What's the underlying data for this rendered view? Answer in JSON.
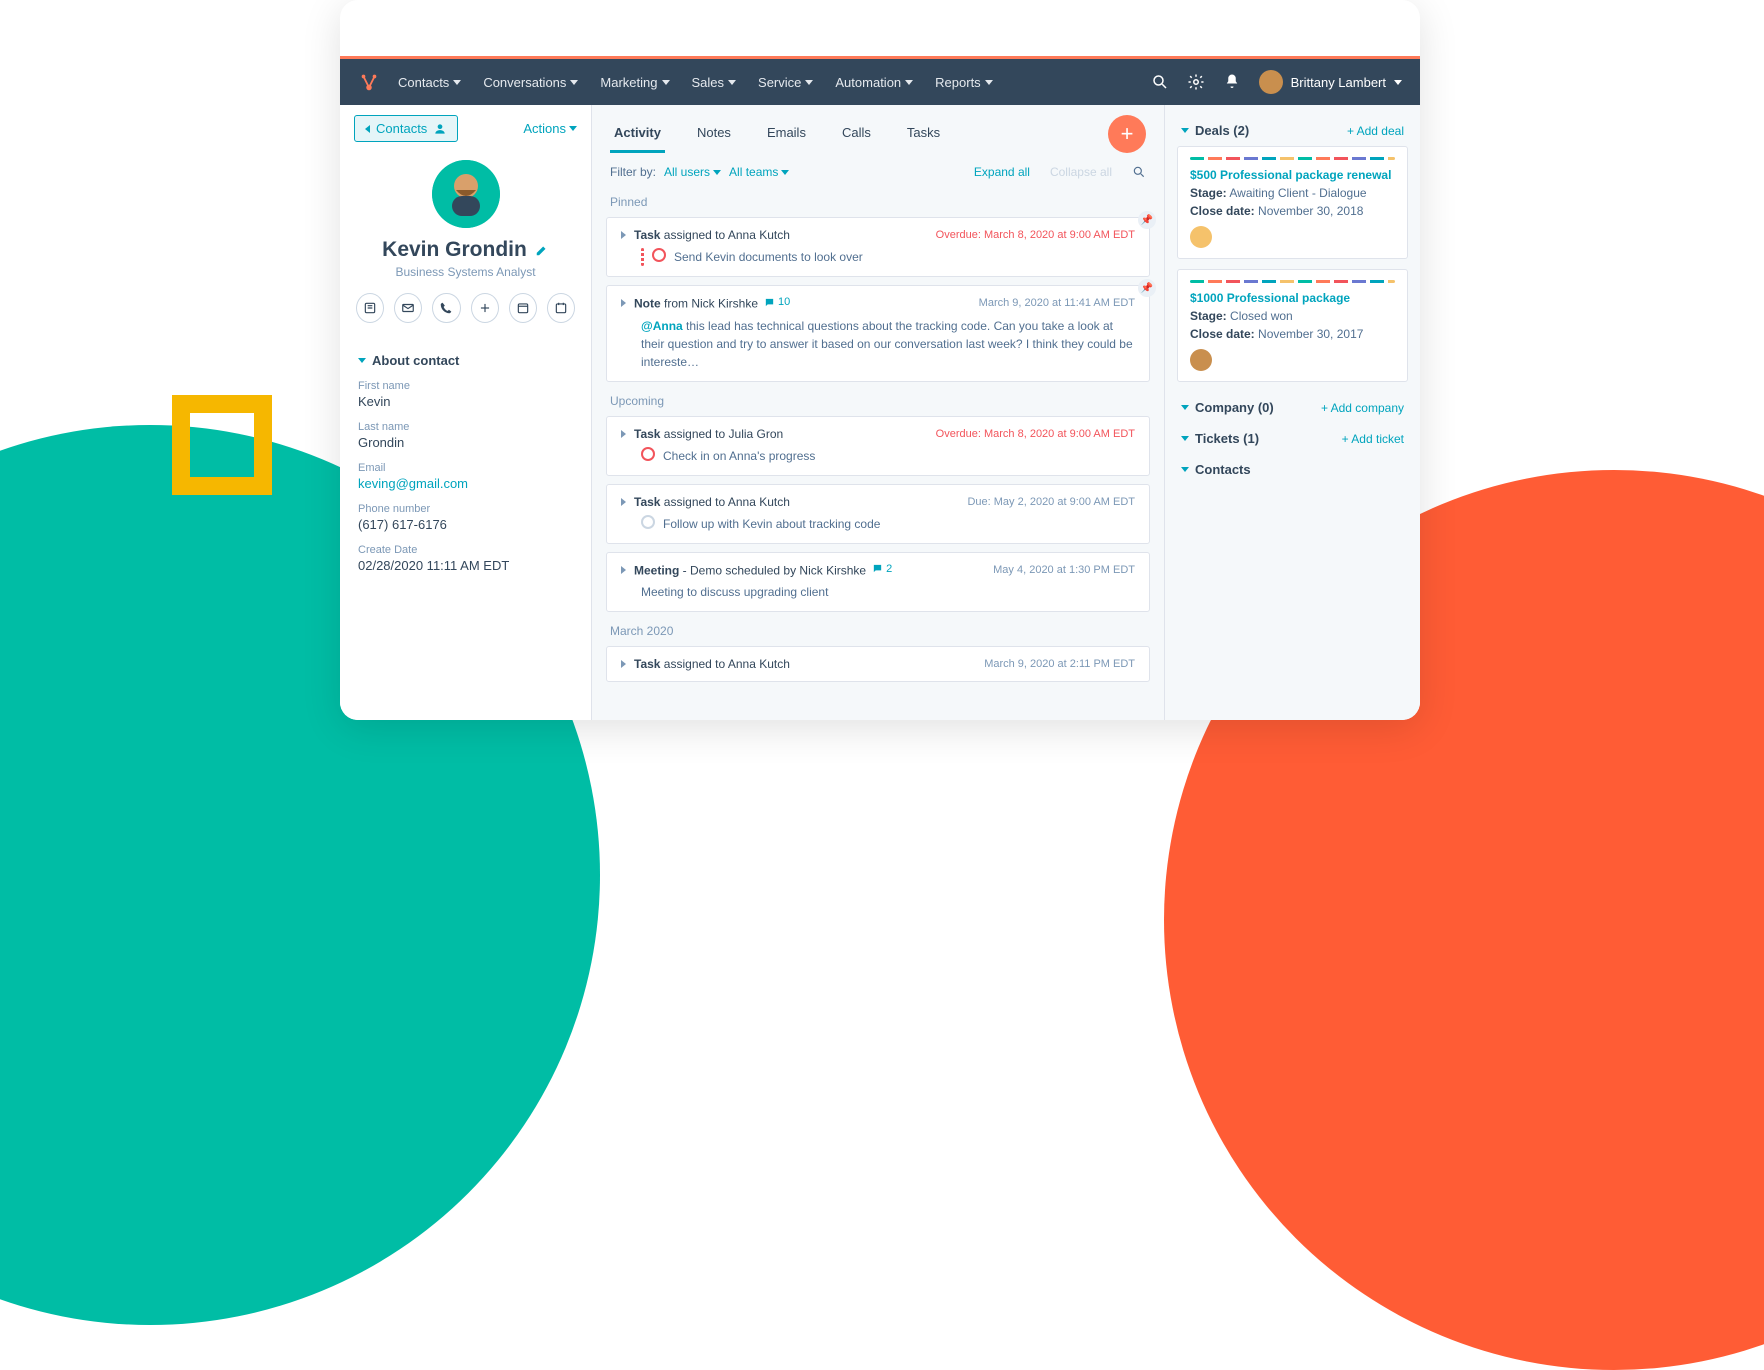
{
  "nav": {
    "items": [
      "Contacts",
      "Conversations",
      "Marketing",
      "Sales",
      "Service",
      "Automation",
      "Reports"
    ],
    "user_name": "Brittany Lambert"
  },
  "left": {
    "back_label": "Contacts",
    "actions_label": "Actions",
    "name": "Kevin Grondin",
    "subtitle": "Business Systems Analyst",
    "about_label": "About contact",
    "fields": [
      {
        "label": "First name",
        "value": "Kevin"
      },
      {
        "label": "Last name",
        "value": "Grondin"
      },
      {
        "label": "Email",
        "value": "keving@gmail.com",
        "link": true
      },
      {
        "label": "Phone number",
        "value": "(617) 617-6176"
      },
      {
        "label": "Create Date",
        "value": "02/28/2020 11:11 AM EDT"
      }
    ]
  },
  "tabs": [
    "Activity",
    "Notes",
    "Emails",
    "Calls",
    "Tasks"
  ],
  "filter": {
    "label": "Filter by:",
    "users": "All users",
    "teams": "All teams",
    "expand": "Expand all",
    "collapse": "Collapse all"
  },
  "sections": {
    "pinned": "Pinned",
    "upcoming": "Upcoming",
    "march": "March 2020"
  },
  "activities": {
    "pinned": [
      {
        "title_bold": "Task",
        "title_rest": " assigned to Anna Kutch",
        "meta": "Overdue: March 8, 2020 at 9:00 AM EDT",
        "overdue": true,
        "body": "Send Kevin documents to look over",
        "status": "red"
      },
      {
        "title_bold": "Note",
        "title_rest": " from Nick Kirshke",
        "comment_count": "10",
        "meta": "March 9, 2020 at 11:41 AM EDT",
        "mention": "@Anna",
        "body": " this lead has technical questions about the tracking code. Can you take a look at their question and try to answer it based on our conversation last week? I think they could be intereste…"
      }
    ],
    "upcoming": [
      {
        "title_bold": "Task",
        "title_rest": " assigned to Julia Gron",
        "meta": "Overdue: March 8, 2020 at 9:00 AM EDT",
        "overdue": true,
        "body": "Check in on Anna's progress",
        "status": "red"
      },
      {
        "title_bold": "Task",
        "title_rest": " assigned to Anna Kutch",
        "meta": "Due: May 2, 2020 at 9:00 AM EDT",
        "body": "Follow up with Kevin about tracking code",
        "status": "grey"
      },
      {
        "title_bold": "Meeting",
        "title_mid": " - Demo",
        "title_rest": " scheduled by Nick Kirshke",
        "comment_count": "2",
        "meta": "May 4, 2020 at 1:30 PM EDT",
        "body": "Meeting to discuss upgrading client"
      }
    ],
    "march": [
      {
        "title_bold": "Task",
        "title_rest": " assigned to Anna Kutch",
        "meta": "March 9, 2020 at 2:11 PM EDT"
      }
    ]
  },
  "right": {
    "deals_label": "Deals (2)",
    "add_deal": "+ Add deal",
    "deals": [
      {
        "title": "$500 Professional package renewal",
        "stage_label": "Stage:",
        "stage": " Awaiting Client - Dialogue",
        "close_label": "Close date:",
        "close": " November 30, 2018"
      },
      {
        "title": "$1000 Professional package",
        "stage_label": "Stage:",
        "stage": " Closed won",
        "close_label": "Close date:",
        "close": " November 30, 2017"
      }
    ],
    "company_label": "Company (0)",
    "add_company": "+ Add company",
    "tickets_label": "Tickets (1)",
    "add_ticket": "+ Add ticket",
    "contacts_label": "Contacts"
  }
}
